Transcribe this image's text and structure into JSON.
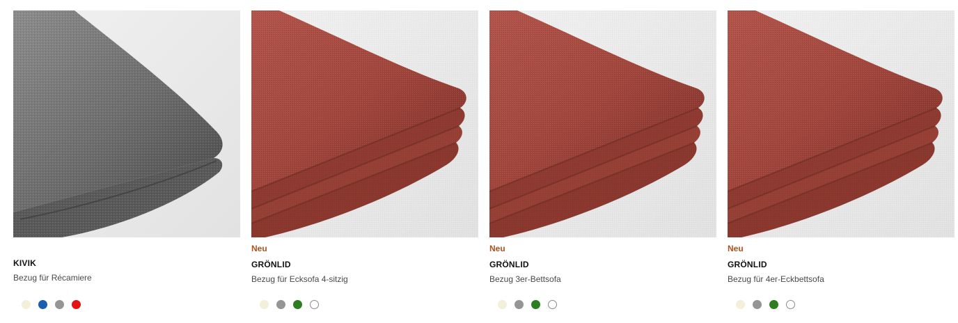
{
  "products": [
    {
      "badge": "",
      "name": "KIVIK",
      "description": "Bezug für Récamiere",
      "fabric": "grey-linen-fabric",
      "colors": [
        "#f3efd8",
        "#1a5eb0",
        "#959595",
        "#e41212"
      ]
    },
    {
      "badge": "Neu",
      "name": "GRÖNLID",
      "description": "Bezug für Ecksofa 4-sitzig",
      "fabric": "rust-red-velvet-fabric",
      "colors": [
        "#f3efd8",
        "#959595",
        "#2e7d22",
        "#ffffff"
      ]
    },
    {
      "badge": "Neu",
      "name": "GRÖNLID",
      "description": "Bezug 3er-Bettsofa",
      "fabric": "rust-red-velvet-fabric",
      "colors": [
        "#f3efd8",
        "#959595",
        "#2e7d22",
        "#ffffff"
      ]
    },
    {
      "badge": "Neu",
      "name": "GRÖNLID",
      "description": "Bezug für 4er-Eckbettsofa",
      "fabric": "rust-red-velvet-fabric",
      "colors": [
        "#f3efd8",
        "#959595",
        "#2e7d22",
        "#ffffff"
      ]
    }
  ]
}
